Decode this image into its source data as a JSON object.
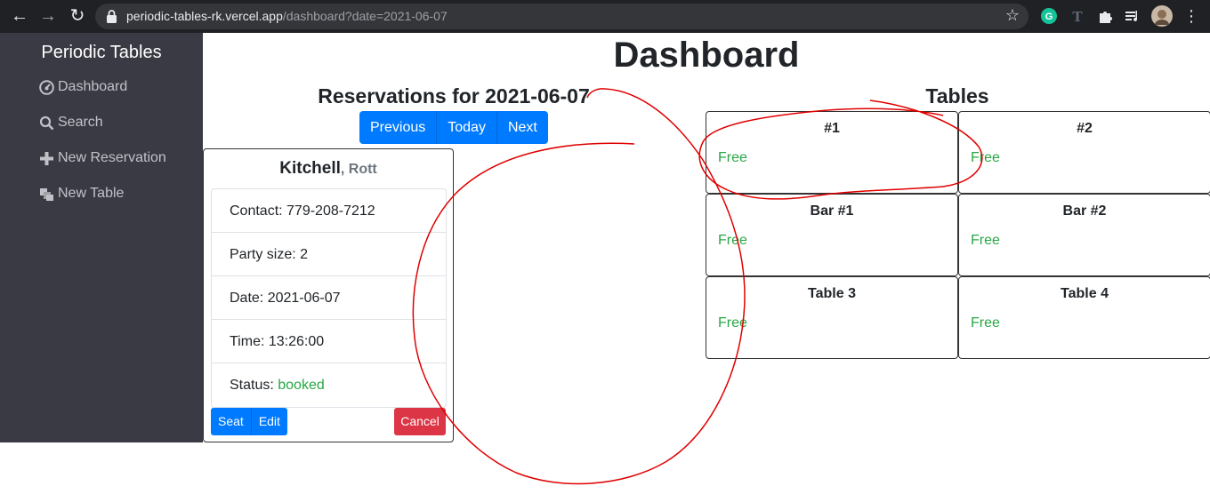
{
  "browser": {
    "url_host": "periodic-tables-rk.vercel.app",
    "url_path": "/dashboard?date=2021-06-07"
  },
  "sidebar": {
    "brand": "Periodic Tables",
    "items": [
      {
        "label": "Dashboard",
        "icon": "dashboard-icon"
      },
      {
        "label": "Search",
        "icon": "search-icon"
      },
      {
        "label": "New Reservation",
        "icon": "plus-icon"
      },
      {
        "label": "New Table",
        "icon": "layers-icon"
      }
    ]
  },
  "main": {
    "title": "Dashboard",
    "reservations_heading": "Reservations for 2021-06-07",
    "tables_heading": "Tables",
    "date_nav": {
      "previous": "Previous",
      "today": "Today",
      "next": "Next"
    }
  },
  "reservation": {
    "last_name": "Kitchell",
    "first_name": ", Rott",
    "contact_label": "Contact: ",
    "contact": "779-208-7212",
    "party_label": "Party size: ",
    "party_size": "2",
    "date_label": "Date: ",
    "date": "2021-06-07",
    "time_label": "Time: ",
    "time": "13:26:00",
    "status_label": "Status: ",
    "status": "booked",
    "seat_label": "Seat",
    "edit_label": "Edit",
    "cancel_label": "Cancel"
  },
  "tables": [
    {
      "name": "#1",
      "status": "Free"
    },
    {
      "name": "#2",
      "status": "Free"
    },
    {
      "name": "Bar #1",
      "status": "Free"
    },
    {
      "name": "Bar #2",
      "status": "Free"
    },
    {
      "name": "Table 3",
      "status": "Free"
    },
    {
      "name": "Table 4",
      "status": "Free"
    }
  ],
  "colors": {
    "primary": "#007bff",
    "danger": "#dc3545",
    "success": "#28a745",
    "annotation": "#e00000"
  }
}
